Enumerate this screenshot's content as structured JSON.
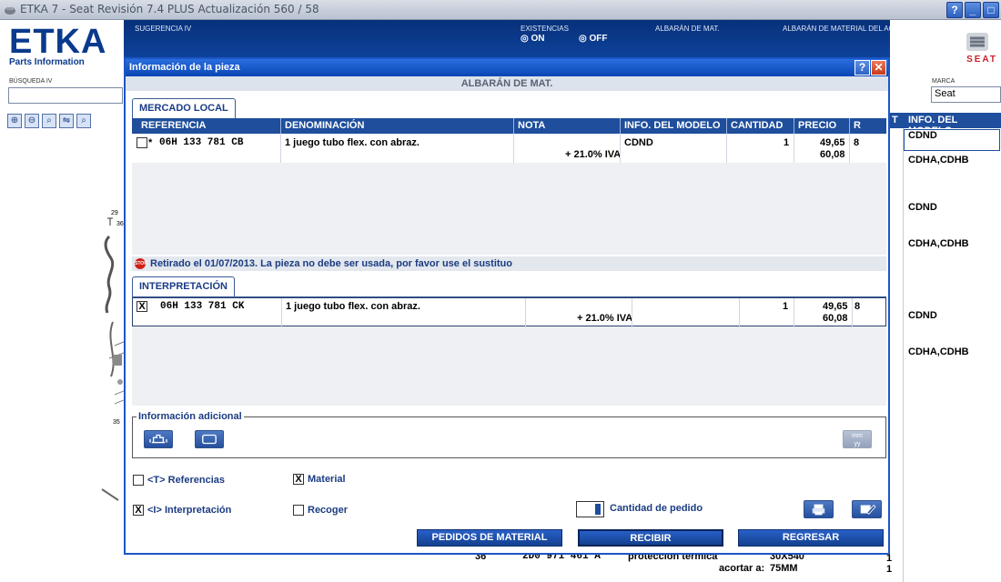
{
  "window": {
    "title": "ETKA 7 - Seat Revisión 7.4 PLUS Actualización 560 / 58",
    "btn_help": "?",
    "btn_min": "_",
    "btn_max": "□"
  },
  "header": {
    "logo": "ETKA",
    "logo_sub": "Parts Information",
    "sugerencia_label": "SUGERENCIA IV",
    "existencias_label": "EXISTENCIAS",
    "on_label": "ON",
    "off_label": "OFF",
    "albaran_label": "ALBARÁN DE MAT.",
    "albaran_acr_label": "ALBARÁN DE MATERIAL DEL ACR",
    "brand_text": "SEAT"
  },
  "search": {
    "label": "BÚSQUEDA IV",
    "value": "",
    "marca_label": "MARCA",
    "marca_value": "Seat"
  },
  "background": {
    "hdr_t": "T",
    "hdr_info": "INFO. DEL MODELO",
    "models": [
      "CDND",
      "CDHA,CDHB",
      "CDND",
      "CDHA,CDHB",
      "CDND",
      "CDHA,CDHB"
    ],
    "drawing_labels": [
      "29",
      "36",
      "35"
    ],
    "bottom_pos": "36",
    "bottom_ref": "2D0 971 461 A",
    "bottom_desc": "protección térmica",
    "bottom_size": "30X540",
    "bottom_qty1": "1",
    "bottom_acortar": "acortar a:",
    "bottom_mm": "75MM",
    "bottom_qty2": "1"
  },
  "dialog": {
    "title": "Información de la pieza",
    "help": "?",
    "close": "✕",
    "subheader": "ALBARÁN DE MAT.",
    "tab_mercado": "MERCADO LOCAL",
    "tab_interp": "INTERPRETACIÓN",
    "columns": {
      "referencia": "REFERENCIA",
      "denominacion": "DENOMINACIÓN",
      "nota": "NOTA",
      "info_modelo": "INFO. DEL MODELO",
      "cantidad": "CANTIDAD",
      "precio": "PRECIO",
      "r": "R"
    },
    "mercado_row": {
      "marker": "*",
      "ref": "06H 133 781 CB",
      "denominacion": "1 juego tubo flex. con abraz.",
      "nota": "+ 21.0% IVA",
      "info_modelo": "CDND",
      "cantidad": "1",
      "precio": "49,65",
      "precio_iva": "60,08",
      "r": "8"
    },
    "warning": "Retirado el 01/07/2013. La pieza no debe ser usada, por favor use el sustituo",
    "stop": "STOP",
    "interp_row": {
      "ref": "06H 133 781 CK",
      "denominacion": "1 juego tubo flex. con abraz.",
      "nota": "+ 21.0% IVA",
      "cantidad": "1",
      "precio": "49,65",
      "precio_iva": "60,08",
      "r": "8"
    },
    "info_adicional": "Información adicional",
    "calendar_label": "mm\nyy",
    "opt_referencias": "<T> Referencias",
    "opt_material": "Material",
    "opt_interpretacion": "<I> Interpretación",
    "opt_recoger": "Recoger",
    "check_x": "X",
    "cantidad_label": "Cantidad de pedido",
    "cantidad_value": "1",
    "btn_pedidos": "PEDIDOS DE MATERIAL",
    "btn_recibir": "RECIBIR",
    "btn_regresar": "REGRESAR"
  }
}
